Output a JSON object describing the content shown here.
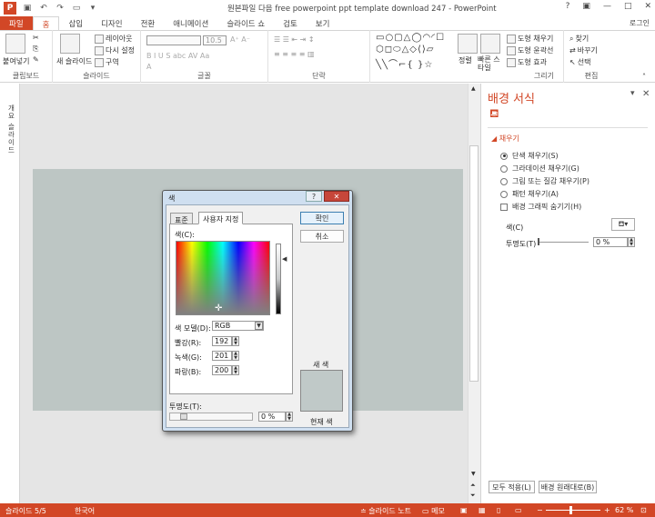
{
  "window": {
    "title": "원본파일 다음 free powerpoint ppt template download 247 - PowerPoint",
    "login": "로그인",
    "app_icon": "P"
  },
  "qat": {
    "icons": [
      "save-icon",
      "undo-icon",
      "redo-icon",
      "present-icon",
      "customize-icon"
    ]
  },
  "tabs": [
    "파일",
    "홈",
    "삽입",
    "디자인",
    "전환",
    "애니메이션",
    "슬라이드 쇼",
    "검토",
    "보기"
  ],
  "active_tab": "홈",
  "ribbon": {
    "clipboard": {
      "label": "클립보드",
      "paste": "붙여넣기"
    },
    "slides": {
      "label": "슬라이드",
      "new_slide": "새 슬라이드",
      "layout": "레이아웃",
      "reset": "다시 설정",
      "section": "구역"
    },
    "font": {
      "label": "글꼴",
      "size": "10.5"
    },
    "paragraph": {
      "label": "단락"
    },
    "drawing": {
      "label": "그리기",
      "arrange": "정렬",
      "quick_styles": "빠른 스타일",
      "fill": "도형 채우기",
      "outline": "도형 윤곽선",
      "effects": "도형 효과"
    },
    "editing": {
      "label": "편집",
      "find": "찾기",
      "replace": "바꾸기",
      "select": "선택"
    }
  },
  "left_pane": {
    "label": "개요 슬라이드"
  },
  "format_pane": {
    "title": "배경 서식",
    "section": "채우기",
    "options": [
      {
        "label": "단색 채우기(S)",
        "selected": true
      },
      {
        "label": "그라데이션 채우기(G)",
        "selected": false
      },
      {
        "label": "그림 또는 질감 채우기(P)",
        "selected": false
      },
      {
        "label": "패턴 채우기(A)",
        "selected": false
      }
    ],
    "hide_graphics": "배경 그래픽 숨기기(H)",
    "color_label": "색(C)",
    "transparency_label": "투명도(T)",
    "transparency_value": "0 %",
    "apply_all": "모두 적용(L)",
    "reset_bg": "배경 원래대로(B)"
  },
  "dialog": {
    "title": "색",
    "help": "?",
    "tabs": [
      "표준",
      "사용자 지정"
    ],
    "active_tab": "사용자 지정",
    "colors_label": "색(C):",
    "model_label": "색 모델(D):",
    "model_value": "RGB",
    "red_label": "빨강(R):",
    "red": "192",
    "green_label": "녹색(G):",
    "green": "201",
    "blue_label": "파랑(B):",
    "blue": "200",
    "ok": "확인",
    "cancel": "취소",
    "new_label": "새 색",
    "current_label": "현재 색",
    "transparency_label": "투명도(T):",
    "transparency_value": "0 %",
    "current_color": "#c0c9c8"
  },
  "status": {
    "slide": "슬라이드 5/5",
    "lang": "한국어",
    "notes": "슬라이드 노트",
    "comments": "메모",
    "zoom": "62 %"
  },
  "colors": {
    "accent": "#d24726",
    "slide_bg": "#bdc6c4"
  }
}
